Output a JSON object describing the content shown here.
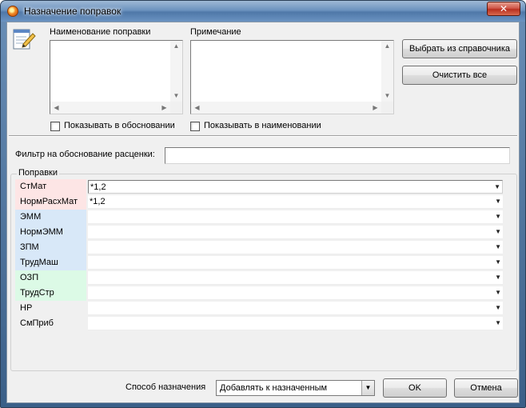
{
  "window": {
    "title": "Назначение поправок",
    "close_glyph": "✕"
  },
  "colors": {
    "pink": "#fde5e5",
    "blue": "#d8e8f8",
    "green": "#dcfae6",
    "none": "#f0f0f0"
  },
  "top": {
    "name_label": "Наименование поправки",
    "note_label": "Примечание",
    "pick_button": "Выбрать из справочника",
    "clear_button": "Очистить все",
    "show_in_justification": "Показывать в обосновании",
    "show_in_name": "Показывать в наименовании"
  },
  "filter": {
    "label": "Фильтр на обоснование расценки:",
    "value": ""
  },
  "corrections": {
    "caption": "Поправки",
    "rows": [
      {
        "label": "СтМат",
        "value": "*1,2",
        "group": "pink"
      },
      {
        "label": "НормРасхМат",
        "value": "*1,2",
        "group": "pink"
      },
      {
        "label": "ЭММ",
        "value": "",
        "group": "blue"
      },
      {
        "label": "НормЭММ",
        "value": "",
        "group": "blue"
      },
      {
        "label": "ЗПМ",
        "value": "",
        "group": "blue"
      },
      {
        "label": "ТрудМаш",
        "value": "",
        "group": "blue"
      },
      {
        "label": "ОЗП",
        "value": "",
        "group": "green"
      },
      {
        "label": "ТрудСтр",
        "value": "",
        "group": "green"
      },
      {
        "label": "НР",
        "value": "",
        "group": "none"
      },
      {
        "label": "СмПриб",
        "value": "",
        "group": "none"
      }
    ]
  },
  "footer": {
    "method_label": "Способ назначения",
    "method_value": "Добавлять к назначенным",
    "ok_button": "OK",
    "cancel_button": "Отмена"
  }
}
